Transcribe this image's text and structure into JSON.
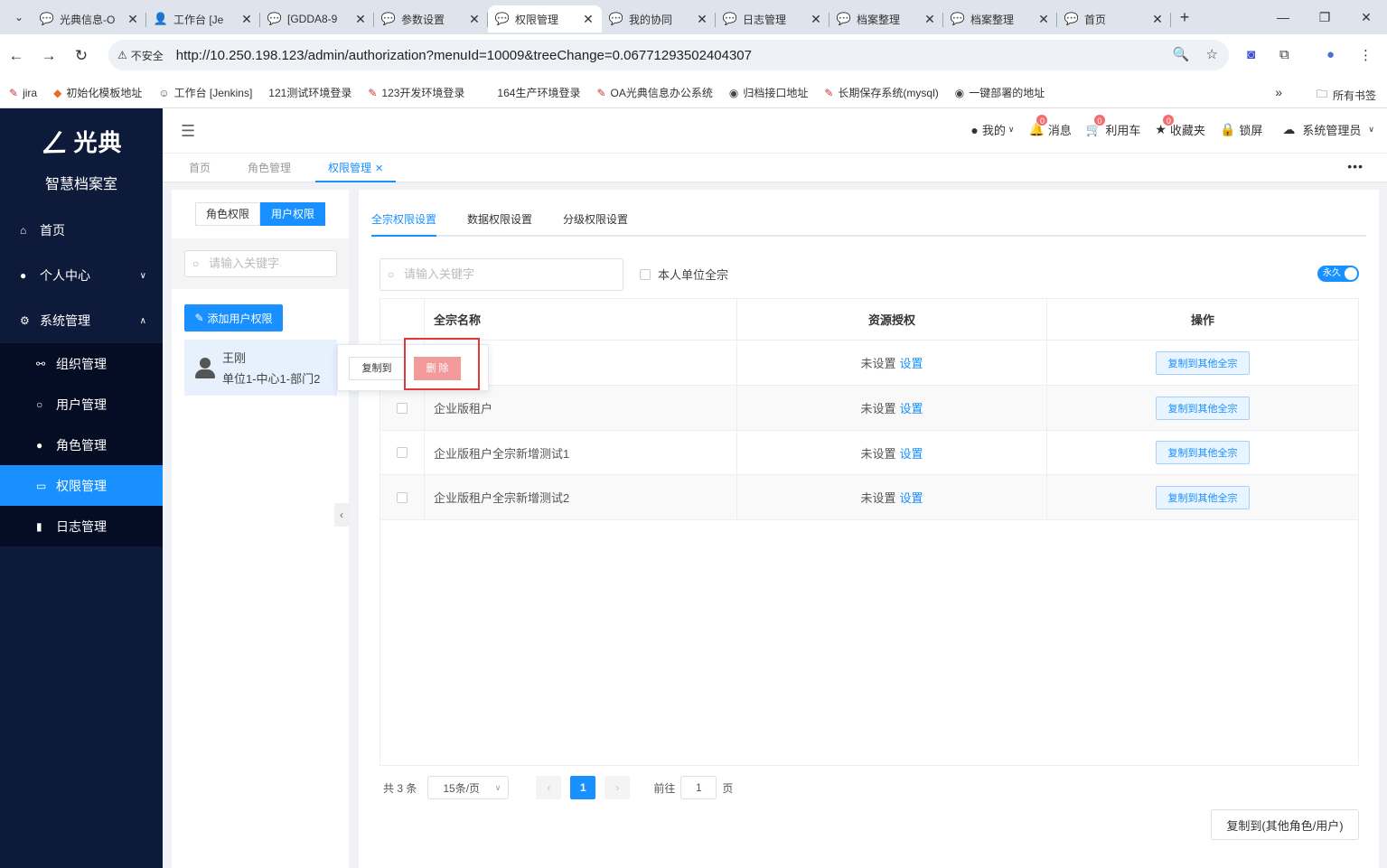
{
  "browser": {
    "tabs": [
      {
        "label": "光典信息-O",
        "icon": "💬"
      },
      {
        "label": "工作台 [Je",
        "icon": "👤"
      },
      {
        "label": "[GDDA8-9",
        "icon": "💬"
      },
      {
        "label": "参数设置",
        "icon": "💬"
      },
      {
        "label": "权限管理",
        "icon": "💬"
      },
      {
        "label": "我的协同",
        "icon": "💬"
      },
      {
        "label": "日志管理",
        "icon": "💬"
      },
      {
        "label": "档案整理",
        "icon": "💬"
      },
      {
        "label": "档案整理",
        "icon": "💬"
      },
      {
        "label": "首页",
        "icon": "💬"
      }
    ],
    "insecure_label": "不安全",
    "url": "http://10.250.198.123/admin/authorization?menuId=10009&treeChange=0.06771293502404307",
    "bookmarks": [
      {
        "label": "jira"
      },
      {
        "label": "初始化模板地址"
      },
      {
        "label": "工作台 [Jenkins]"
      },
      {
        "label": "121测试环境登录"
      },
      {
        "label": "123开发环境登录"
      },
      {
        "label": "164生产环境登录"
      },
      {
        "label": "OA光典信息办公系统"
      },
      {
        "label": "归档接口地址"
      },
      {
        "label": "长期保存系统(mysql)"
      },
      {
        "label": "一键部署的地址"
      }
    ],
    "all_bookmarks": "所有书签"
  },
  "sidebar": {
    "brand": "光典",
    "subtitle": "智慧档案室",
    "items": [
      {
        "label": "首页"
      },
      {
        "label": "个人中心"
      },
      {
        "label": "系统管理"
      }
    ],
    "subitems": [
      {
        "label": "组织管理"
      },
      {
        "label": "用户管理"
      },
      {
        "label": "角色管理"
      },
      {
        "label": "权限管理"
      },
      {
        "label": "日志管理"
      }
    ]
  },
  "header": {
    "mine": "我的",
    "messages": "消息",
    "messages_count": "0",
    "cart": "利用车",
    "cart_count": "0",
    "favorites": "收藏夹",
    "favorites_count": "0",
    "lock": "锁屏",
    "user": "系统管理员"
  },
  "view_tabs": [
    "首页",
    "角色管理",
    "权限管理"
  ],
  "left_panel": {
    "seg_role": "角色权限",
    "seg_user": "用户权限",
    "search_placeholder": "请输入关键字",
    "add_button": "添加用户权限",
    "user_name": "王刚",
    "user_dept": "单位1-中心1-部门2",
    "popover_copy": "复制到",
    "popover_delete": "删 除"
  },
  "main": {
    "sub_tabs": [
      "全宗权限设置",
      "数据权限设置",
      "分级权限设置"
    ],
    "search_placeholder": "请输入关键字",
    "checkbox_label": "本人单位全宗",
    "toggle_label": "永久",
    "columns": [
      "全宗名称",
      "资源授权",
      "操作"
    ],
    "rows": [
      {
        "name": "",
        "status": "未设置",
        "link": "设置",
        "action": "复制到其他全宗"
      },
      {
        "name": "企业版租户",
        "status": "未设置",
        "link": "设置",
        "action": "复制到其他全宗"
      },
      {
        "name": "企业版租户全宗新增测试1",
        "status": "未设置",
        "link": "设置",
        "action": "复制到其他全宗"
      },
      {
        "name": "企业版租户全宗新增测试2",
        "status": "未设置",
        "link": "设置",
        "action": "复制到其他全宗"
      }
    ],
    "pager": {
      "total": "共 3 条",
      "page_size": "15条/页",
      "current": "1",
      "goto_prefix": "前往",
      "goto_value": "1",
      "goto_suffix": "页"
    },
    "bottom_copy": "复制到(其他角色/用户)"
  },
  "colors": {
    "accent": "#1890ff",
    "sidebar": "#0e1a3a",
    "danger": "#f56c6c"
  }
}
